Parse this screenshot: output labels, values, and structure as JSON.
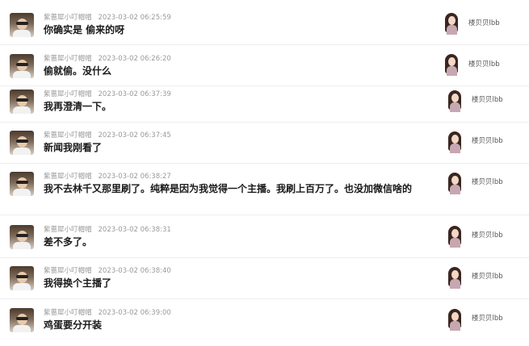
{
  "left_user": {
    "name": "紫蔷犀小叮帽帽",
    "avatar_icon": "user-avatar-icon"
  },
  "right_user": {
    "name": "楼贝贝lbb",
    "avatar_icon": "streamer-avatar-icon"
  },
  "messages": [
    {
      "timestamp": "2023-03-02 06:25:59",
      "text": "你确实是  偷来的呀"
    },
    {
      "timestamp": "2023-03-02 06:26:20",
      "text": "偷就偷。没什么"
    },
    {
      "timestamp": "2023-03-02 06:37:39",
      "text": "我再澄清一下。"
    },
    {
      "timestamp": "2023-03-02 06:37:45",
      "text": "新闻我刚看了"
    },
    {
      "timestamp": "2023-03-02 06:38:27",
      "text": "我不去林千又那里刷了。纯粹是因为我觉得一个主播。我刷上百万了。也没加微信啥的"
    },
    {
      "timestamp": "2023-03-02 06:38:31",
      "text": "差不多了。"
    },
    {
      "timestamp": "2023-03-02 06:38:40",
      "text": "我得换个主播了"
    },
    {
      "timestamp": "2023-03-02 06:39:00",
      "text": "鸡蛋要分开装"
    }
  ]
}
